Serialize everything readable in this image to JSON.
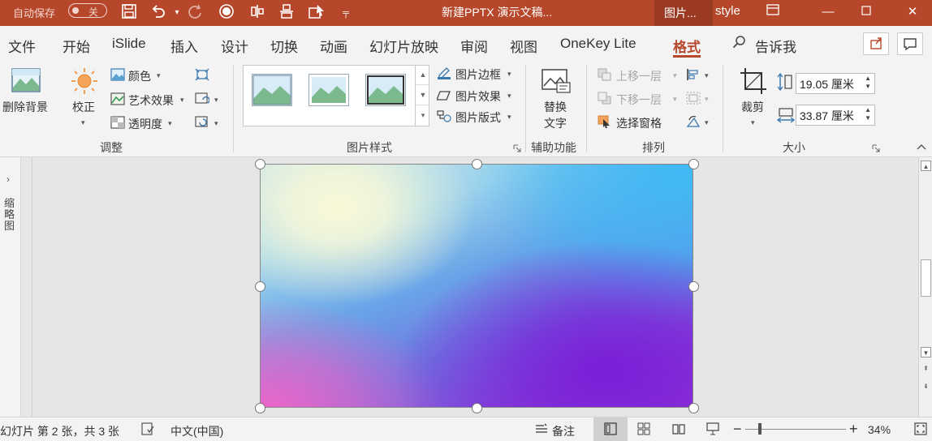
{
  "titlebar": {
    "autosave_label": "自动保存",
    "autosave_state": "关",
    "document_title": "新建PPTX 演示文稿...",
    "context_tab": "图片...",
    "context_style": "style",
    "colors": {
      "bar": "#b7472a",
      "context": "#9b3a22"
    }
  },
  "menu": {
    "tabs": [
      "文件",
      "开始",
      "iSlide",
      "插入",
      "设计",
      "切换",
      "动画",
      "幻灯片放映",
      "审阅",
      "视图",
      "OneKey Lite",
      "格式"
    ],
    "active_tab": "格式",
    "tell_me": "告诉我",
    "accent": "#b7472a"
  },
  "ribbon": {
    "adjust": {
      "label": "调整",
      "remove_bg": "删除背景",
      "correct": "校正",
      "color": "颜色",
      "artistic": "艺术效果",
      "transparency": "透明度"
    },
    "styles": {
      "label": "图片样式",
      "border": "图片边框",
      "effects": "图片效果",
      "layout": "图片版式"
    },
    "accessibility": {
      "label": "辅助功能",
      "alt_text_line1": "替换",
      "alt_text_line2": "文字"
    },
    "arrange": {
      "label": "排列",
      "bring_forward": "上移一层",
      "send_backward": "下移一层",
      "selection_pane": "选择窗格"
    },
    "size": {
      "label": "大小",
      "crop": "裁剪",
      "height": "19.05 厘米",
      "width": "33.87 厘米"
    }
  },
  "left_pane": {
    "label": "缩略图"
  },
  "statusbar": {
    "slide_info": "幻灯片 第 2 张，共 3 张",
    "language": "中文(中国)",
    "notes": "备注",
    "zoom": "34%",
    "zoom_level": 0.34
  }
}
